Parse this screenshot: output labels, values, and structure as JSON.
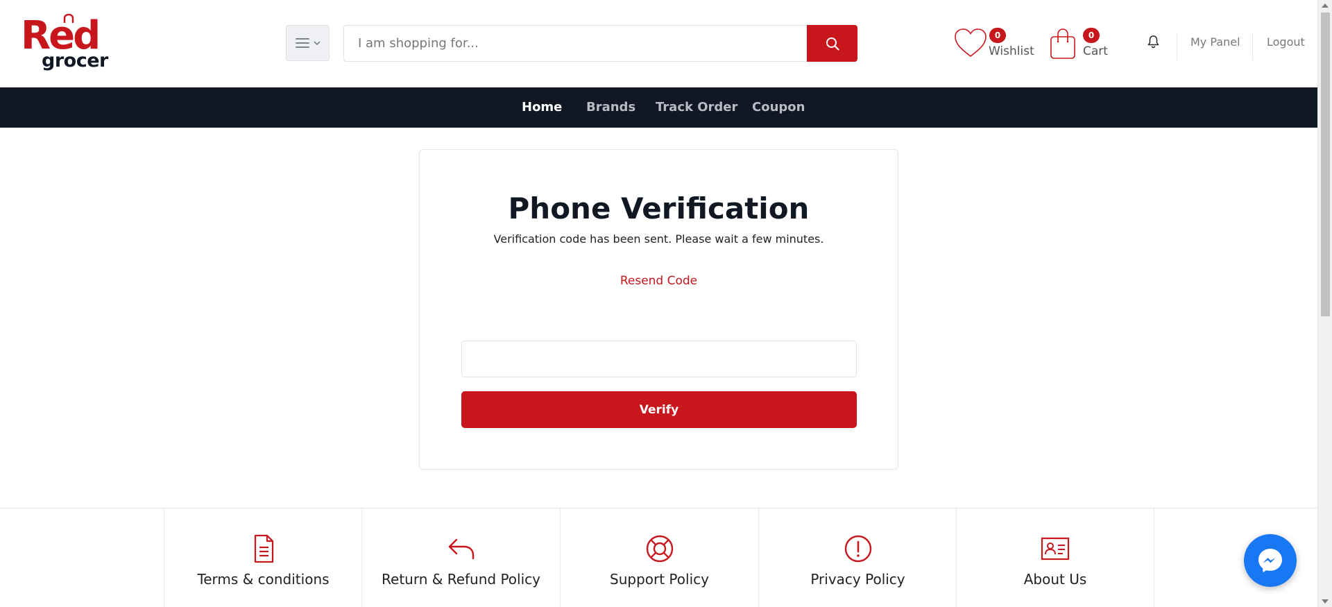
{
  "brand": {
    "logo_top": "Red",
    "logo_bottom": "grocer",
    "accent_color": "#c8161d",
    "dark_color": "#111723"
  },
  "header": {
    "search_placeholder": "I am shopping for...",
    "wishlist": {
      "label": "Wishlist",
      "count": "0"
    },
    "cart": {
      "label": "Cart",
      "count": "0"
    },
    "my_panel": "My Panel",
    "logout": "Logout"
  },
  "nav": {
    "items": [
      {
        "label": "Home",
        "active": true
      },
      {
        "label": "Brands",
        "active": false
      },
      {
        "label": "Track Order",
        "active": false
      },
      {
        "label": "Coupon",
        "active": false
      }
    ]
  },
  "verification": {
    "title": "Phone Verification",
    "message": "Verification code has been sent. Please wait a few minutes.",
    "resend_label": "Resend Code",
    "code_value": "",
    "verify_label": "Verify"
  },
  "policies": [
    {
      "label": "Terms & conditions",
      "icon": "document-icon"
    },
    {
      "label": "Return & Refund Policy",
      "icon": "reply-arrow-icon"
    },
    {
      "label": "Support Policy",
      "icon": "lifebuoy-icon"
    },
    {
      "label": "Privacy Policy",
      "icon": "alert-circle-icon"
    },
    {
      "label": "About Us",
      "icon": "id-card-icon"
    }
  ],
  "icons": {
    "category": "hamburger-menu-icon",
    "search": "search-icon",
    "wishlist": "heart-icon",
    "cart": "shopping-bag-icon",
    "notifications": "bell-icon",
    "chat": "messenger-icon"
  }
}
